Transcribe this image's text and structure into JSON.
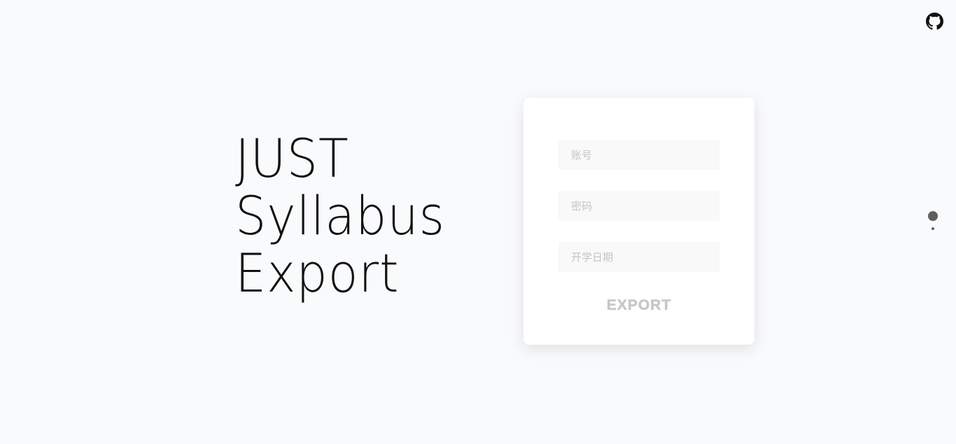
{
  "hero": {
    "lines": [
      "JUST",
      "Syllabus",
      "Export"
    ]
  },
  "form": {
    "account_placeholder": "账号",
    "password_placeholder": "密码",
    "date_placeholder": "开学日期",
    "export_label": "EXPORT"
  },
  "github": {
    "icon": "github-icon"
  },
  "pager": {
    "pages": 2,
    "active_index": 0
  },
  "colors": {
    "background": "#f9fafc",
    "card": "#ffffff",
    "field": "#f9f9f9",
    "placeholder": "#c4c4c4",
    "button_text": "#c8c8c8",
    "dot": "#5f5f5f"
  }
}
